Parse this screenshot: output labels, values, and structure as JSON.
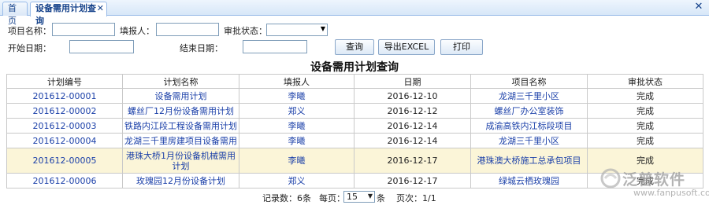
{
  "tabs": {
    "home_label": "首页",
    "active_label": "设备需用计划查询",
    "tab_close_glyph": "✕",
    "window_close_glyph": "✕"
  },
  "form": {
    "project_name_label": "项目名称：",
    "reporter_label": "填报人：",
    "approval_status_label": "审批状态：",
    "start_date_label": "开始日期：",
    "end_date_label": "结束日期：",
    "approval_status_value": "",
    "query_button": "查询",
    "export_button": "导出EXCEL",
    "print_button": "打印"
  },
  "page_title": "设备需用计划查询",
  "table": {
    "headers": [
      "计划编号",
      "计划名称",
      "填报人",
      "日期",
      "项目名称",
      "审批状态"
    ],
    "rows": [
      [
        "201612-00001",
        "设备需用计划",
        "李曦",
        "2016-12-10",
        "龙湖三千里小区",
        "完成"
      ],
      [
        "201612-00002",
        "螺丝厂12月份设备需用计划",
        "郑义",
        "2016-12-12",
        "螺丝厂办公室装饰",
        "完成"
      ],
      [
        "201612-00003",
        "铁路内江段工程设备需用计划",
        "李曦",
        "2016-12-14",
        "成渝高铁内江标段项目",
        "完成"
      ],
      [
        "201612-00004",
        "龙湖三千里房建项目设备需用",
        "李曦",
        "2016-12-14",
        "龙湖三千里小区",
        "完成"
      ],
      [
        "201612-00005",
        "港珠大桥1月份设备机械需用计划",
        "李曦",
        "2016-12-17",
        "港珠澳大桥施工总承包项目",
        "完成"
      ],
      [
        "201612-00006",
        "玫瑰园12月份设备计划",
        "郑义",
        "2016-12-17",
        "绿城云栖玫瑰园",
        "完成"
      ]
    ]
  },
  "pager": {
    "record_count": "记录数：6条",
    "per_page_label": "每页：",
    "per_page_value": "15",
    "per_page_unit": "条",
    "page_info": "页次：1/1"
  },
  "logo": {
    "name": "泛普软件",
    "url": "www.fanpusoft.com"
  },
  "colors": {
    "link": "#1a3fa8",
    "highlight_row": "#fbf5d8",
    "tab_border": "#99bbe8"
  }
}
